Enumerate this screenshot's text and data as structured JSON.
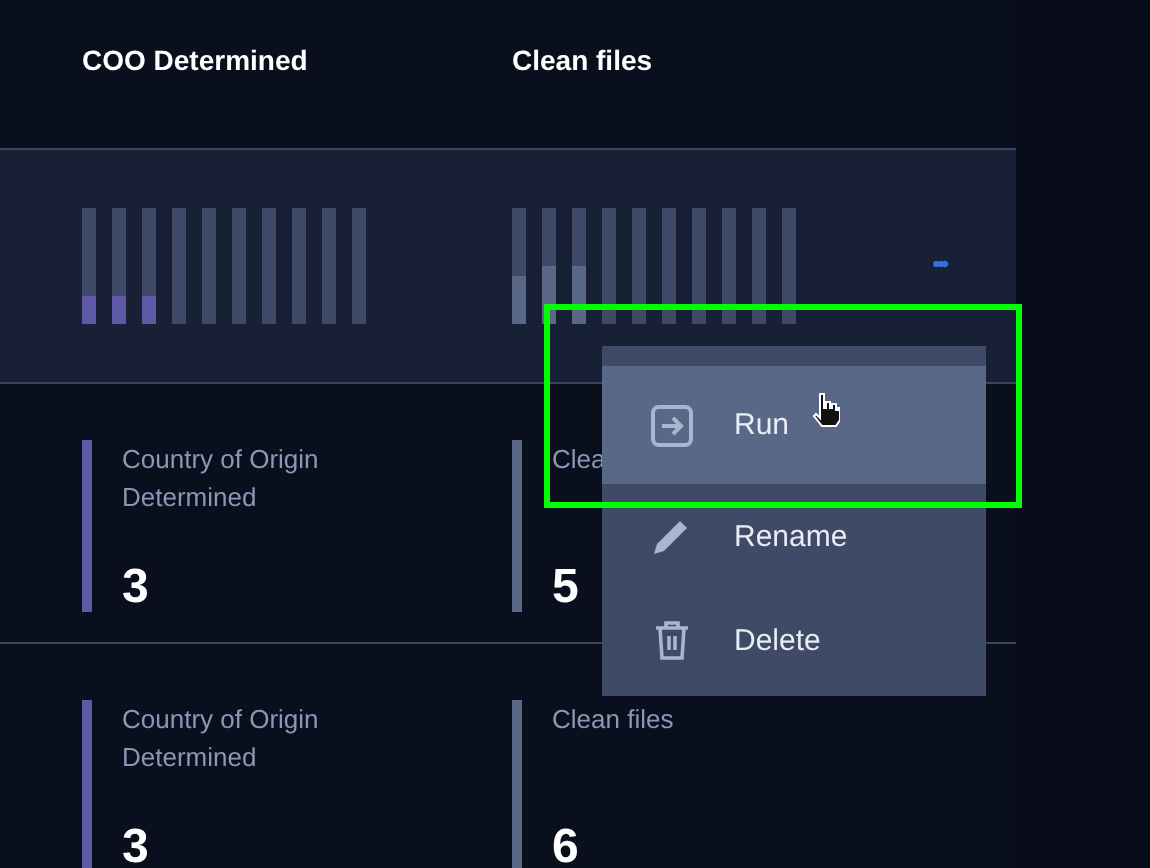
{
  "columns": [
    "COO Determined",
    "Clean files"
  ],
  "rows": [
    {
      "kind": "meters",
      "selected": true,
      "menu_button": "•••",
      "cells": [
        {
          "color": "#5f5aa8",
          "bars": [
            {
              "level": 0.24
            },
            {
              "level": 0.24
            },
            {
              "level": 0.24
            }
          ]
        },
        {
          "color": "#5a6888",
          "bars": [
            {
              "level": 0.41
            },
            {
              "level": 0.5
            },
            {
              "level": 0.5
            }
          ]
        }
      ]
    },
    {
      "kind": "cards",
      "selected": false,
      "cells": [
        {
          "color": "#5f5aa8",
          "label": "Country of Origin Determined",
          "value": "3"
        },
        {
          "color": "#5a6888",
          "label": "Clea",
          "value": "5"
        }
      ]
    },
    {
      "kind": "cards",
      "selected": false,
      "cells": [
        {
          "color": "#5f5aa8",
          "label": "Country of Origin Determined",
          "value": "3"
        },
        {
          "color": "#5a6888",
          "label": "Clean files",
          "value": "6"
        }
      ]
    }
  ],
  "menu": {
    "items": [
      {
        "kind": "run",
        "label": "Run",
        "selected": true
      },
      {
        "kind": "rename",
        "label": "Rename",
        "selected": false
      },
      {
        "kind": "delete",
        "label": "Delete",
        "selected": false
      }
    ]
  }
}
